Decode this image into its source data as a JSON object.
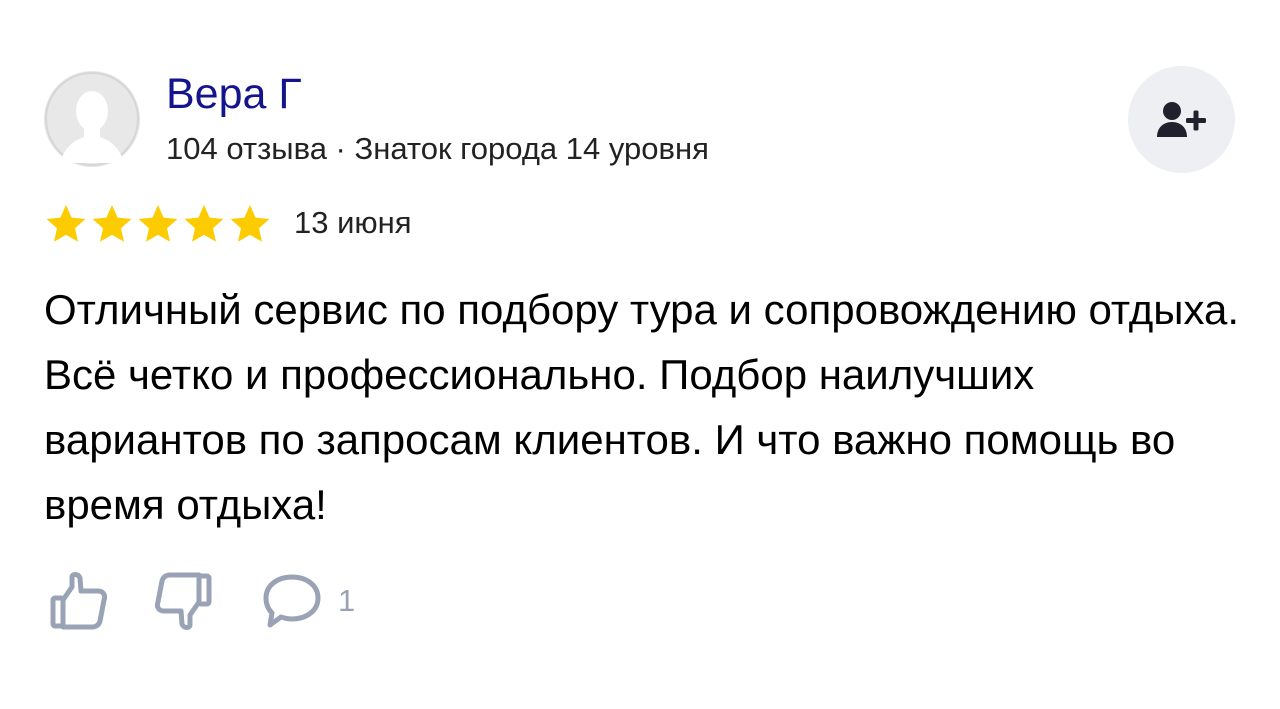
{
  "author": {
    "name": "Вера Г",
    "meta": "104 отзыва · Знаток города 14 уровня"
  },
  "review": {
    "rating": 5,
    "rating_max": 5,
    "date": "13 июня",
    "text": "Отличный сервис по подбору тура и сопровождению отдыха. Всё четко и профессионально. Подбор наилучших вариантов по запросам клиентов. И что важно помощь во время отдыха!"
  },
  "actions": {
    "comment_count": "1"
  },
  "icons": {
    "avatar": "user-silhouette-icon",
    "subscribe": "user-plus-icon",
    "star": "star-icon",
    "like": "thumbs-up-icon",
    "dislike": "thumbs-down-icon",
    "comment": "speech-bubble-icon"
  },
  "colors": {
    "author_name": "#14148c",
    "star": "#fccc00",
    "action_icon": "#9aa3b5",
    "subscribe_bg": "#eeeff2"
  }
}
